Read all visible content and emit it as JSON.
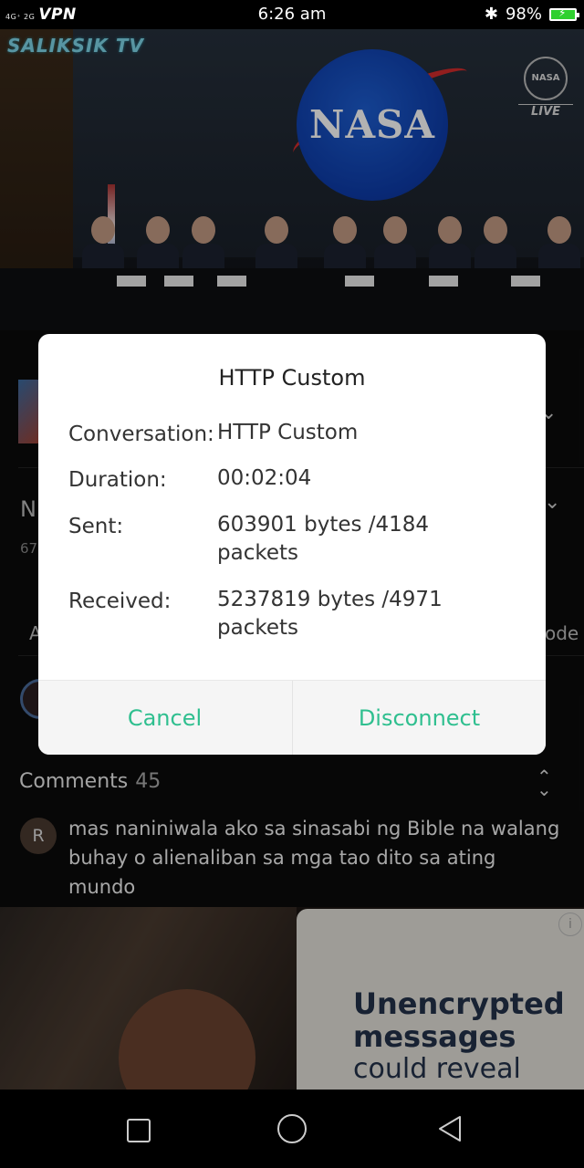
{
  "status_bar": {
    "network": "4G⁺ 2G",
    "vpn": "VPN",
    "time": "6:26 am",
    "bluetooth_icon": "bluetooth-icon",
    "battery": "98%"
  },
  "video": {
    "channel_logo": "SALIKSIK TV",
    "live_badge": "LIVE",
    "nasa_mark": "NASA",
    "badge_mark": "NASA"
  },
  "behind": {
    "title_fragment": "N",
    "views_fragment": "67",
    "tab_fragment_left": "A",
    "tab_fragment_right": "ode"
  },
  "comments": {
    "title": "Comments",
    "count": "45",
    "items": [
      {
        "avatar_letter": "R",
        "text": "mas naniniwala ako sa sinasabi ng Bible na walang buhay o alienaliban sa mga tao dito sa ating mundo"
      }
    ]
  },
  "ad": {
    "headline": "Unencrypted messages",
    "sub": "could reveal",
    "info_icon": "info-icon"
  },
  "dialog": {
    "title": "HTTP Custom",
    "rows": [
      {
        "label": "Conversation:",
        "value": "HTTP Custom"
      },
      {
        "label": "Duration:",
        "value": "00:02:04"
      },
      {
        "label": "Sent:",
        "value": "603901 bytes /4184 packets"
      },
      {
        "label": "Received:",
        "value": "5237819 bytes /4971 packets"
      }
    ],
    "cancel_label": "Cancel",
    "disconnect_label": "Disconnect",
    "accent_color": "#2fbf8f"
  }
}
